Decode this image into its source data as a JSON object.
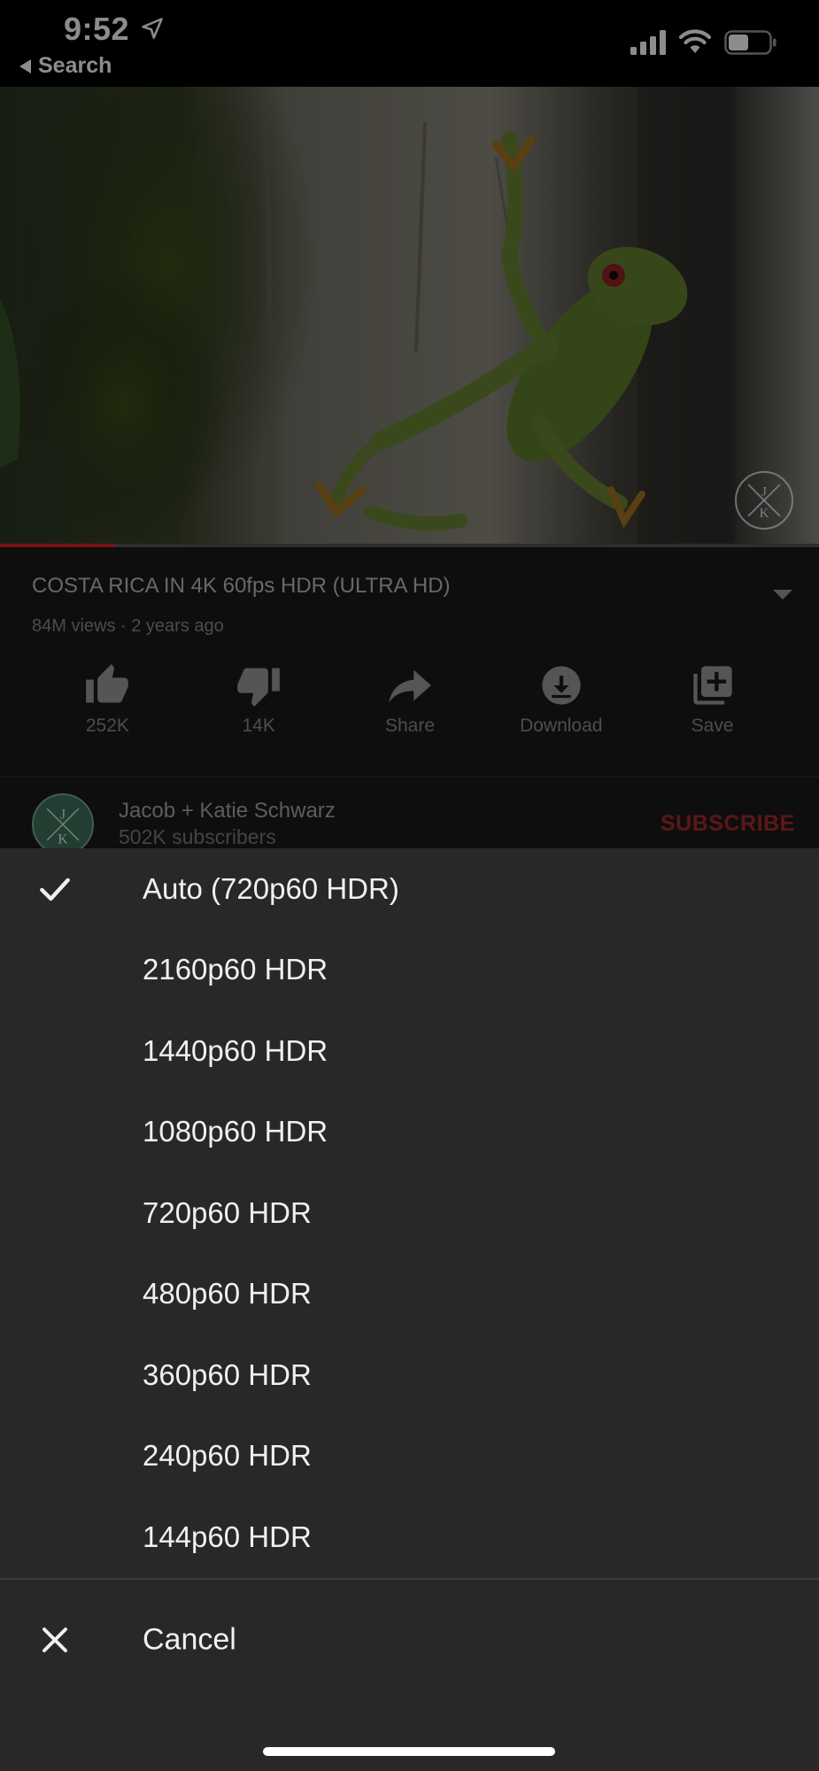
{
  "status_bar": {
    "time": "9:52",
    "back_label": "Search",
    "icons": [
      "location-arrow-icon",
      "cellular-signal-icon",
      "wifi-icon",
      "battery-icon"
    ]
  },
  "video": {
    "title": "COSTA RICA IN 4K 60fps HDR (ULTRA HD)",
    "meta": "84M views · 2 years ago",
    "progress_fraction": 0.14,
    "watermark_letters": [
      "J",
      "K"
    ]
  },
  "actions": [
    {
      "label": "252K",
      "icon": "thumbs-up-icon"
    },
    {
      "label": "14K",
      "icon": "thumbs-down-icon"
    },
    {
      "label": "Share",
      "icon": "share-icon"
    },
    {
      "label": "Download",
      "icon": "download-icon"
    },
    {
      "label": "Save",
      "icon": "add-to-playlist-icon"
    }
  ],
  "channel": {
    "name": "Jacob + Katie Schwarz",
    "subscribers": "502K subscribers",
    "subscribe_label": "SUBSCRIBE",
    "avatar_letters": [
      "J",
      "K"
    ]
  },
  "quality_sheet": {
    "selected_index": 0,
    "options": [
      "Auto (720p60 HDR)",
      "2160p60 HDR",
      "1440p60 HDR",
      "1080p60 HDR",
      "720p60 HDR",
      "480p60 HDR",
      "360p60 HDR",
      "240p60 HDR",
      "144p60 HDR"
    ],
    "cancel_label": "Cancel"
  },
  "colors": {
    "accent_red": "#e52222",
    "subscribe_red": "#a72a2a",
    "sheet_background": "#282828"
  }
}
